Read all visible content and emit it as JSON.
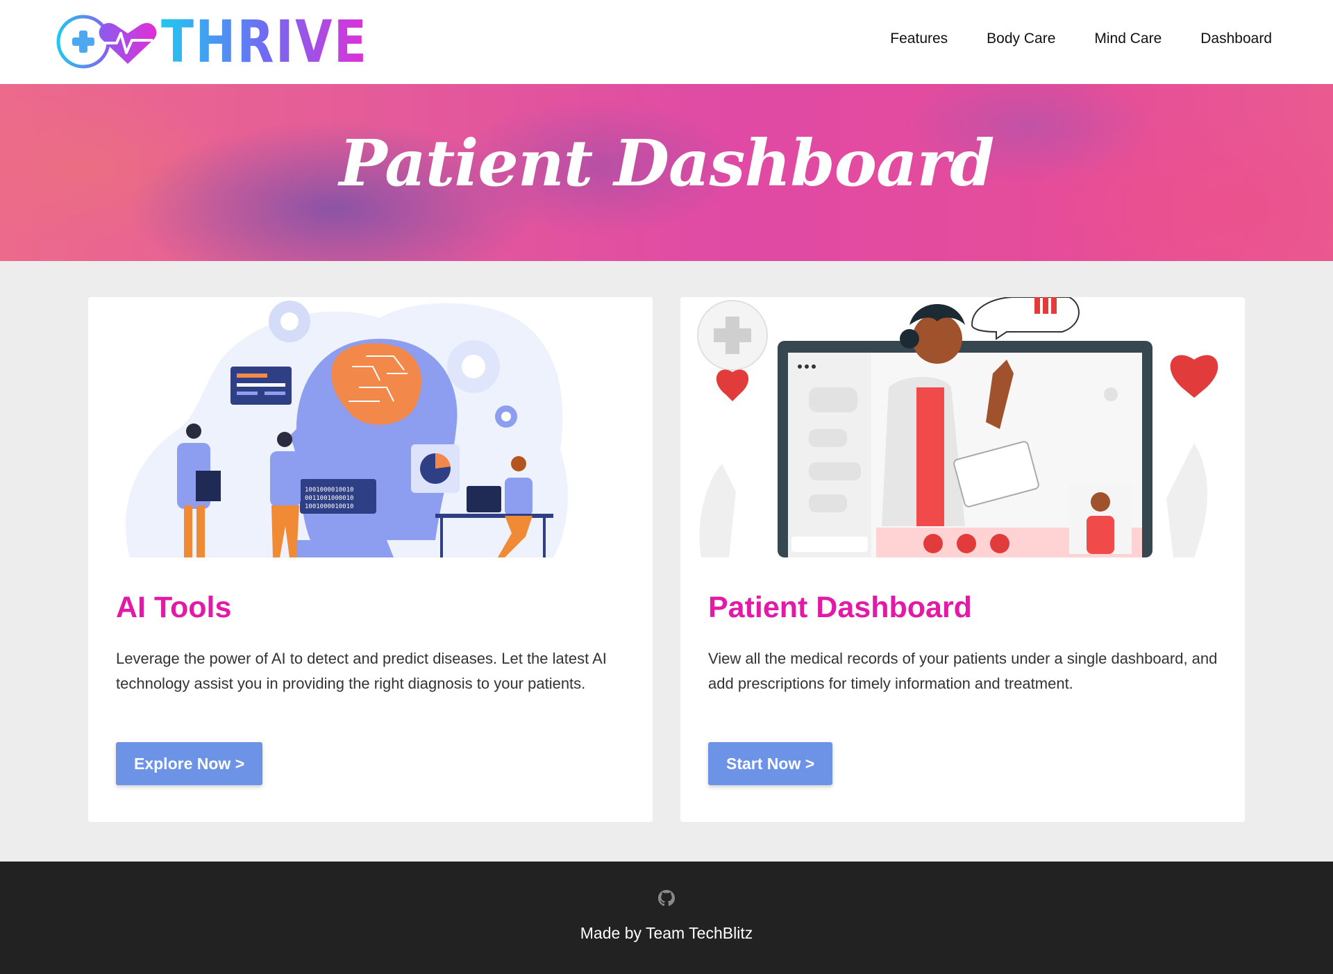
{
  "header": {
    "logo_text": "THRIVE",
    "nav": [
      "Features",
      "Body Care",
      "Mind Care",
      "Dashboard"
    ]
  },
  "hero": {
    "title": "Patient Dashboard"
  },
  "cards": [
    {
      "title": "AI Tools",
      "text": "Leverage the power of AI to detect and predict diseases. Let the latest AI technology assist you in providing the right diagnosis to your patients.",
      "button": "Explore Now >",
      "image_text": "10010000100100011001000010010000100"
    },
    {
      "title": "Patient Dashboard",
      "text": "View all the medical records of your patients under a single dashboard, and add prescriptions for timely information and treatment.",
      "button": "Start Now >"
    }
  ],
  "footer": {
    "text": "Made by Team TechBlitz",
    "icon": "github-icon"
  },
  "colors": {
    "accent_title": "#e31aa8",
    "button": "#6d93e6",
    "footer_bg": "#222222"
  }
}
